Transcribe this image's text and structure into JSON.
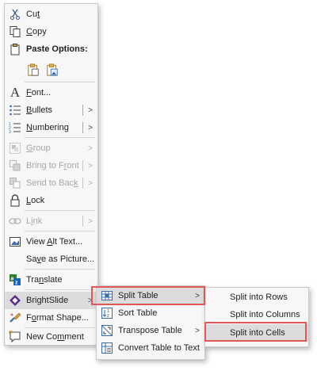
{
  "main_menu": {
    "cut": {
      "pre": "Cu",
      "u": "t",
      "post": ""
    },
    "copy": {
      "pre": "",
      "u": "C",
      "post": "opy"
    },
    "paste_options": "Paste Options:",
    "paste_icons": [
      "paste-keep-formatting-icon",
      "paste-picture-icon"
    ],
    "font": {
      "pre": "",
      "u": "F",
      "post": "ont..."
    },
    "bullets": {
      "pre": "",
      "u": "B",
      "post": "ullets"
    },
    "numbering": {
      "pre": "",
      "u": "N",
      "post": "umbering"
    },
    "group": {
      "pre": "",
      "u": "G",
      "post": "roup"
    },
    "bring_to_front": {
      "pre": "Bring to F",
      "u": "r",
      "post": "ont"
    },
    "send_to_back": {
      "pre": "Send to Bac",
      "u": "k",
      "post": ""
    },
    "lock": {
      "pre": "",
      "u": "L",
      "post": "ock"
    },
    "link": {
      "pre": "L",
      "u": "i",
      "post": "nk"
    },
    "view_alt_text": {
      "pre": "View ",
      "u": "A",
      "post": "lt Text..."
    },
    "save_as_picture": {
      "pre": "Sa",
      "u": "v",
      "post": "e as Picture..."
    },
    "translate": {
      "pre": "Tra",
      "u": "n",
      "post": "slate"
    },
    "brightslide": {
      "pre": "BrightSlide",
      "u": "",
      "post": ""
    },
    "format_shape": {
      "pre": "F",
      "u": "o",
      "post": "rmat Shape..."
    },
    "new_comment": {
      "pre": "New Co",
      "u": "m",
      "post": "ment"
    }
  },
  "brightslide_menu": {
    "split_table": "Split Table",
    "sort_table": "Sort Table",
    "transpose_table": "Transpose Table",
    "convert_table_to_text": "Convert Table to Text"
  },
  "split_table_menu": {
    "split_into_rows": "Split into Rows",
    "split_into_columns": "Split into Columns",
    "split_into_cells": "Split into Cells"
  },
  "colors": {
    "highlight_box": "#e05757",
    "menu_bg": "#f7f7f7",
    "disabled_text": "#a6a6a6"
  }
}
